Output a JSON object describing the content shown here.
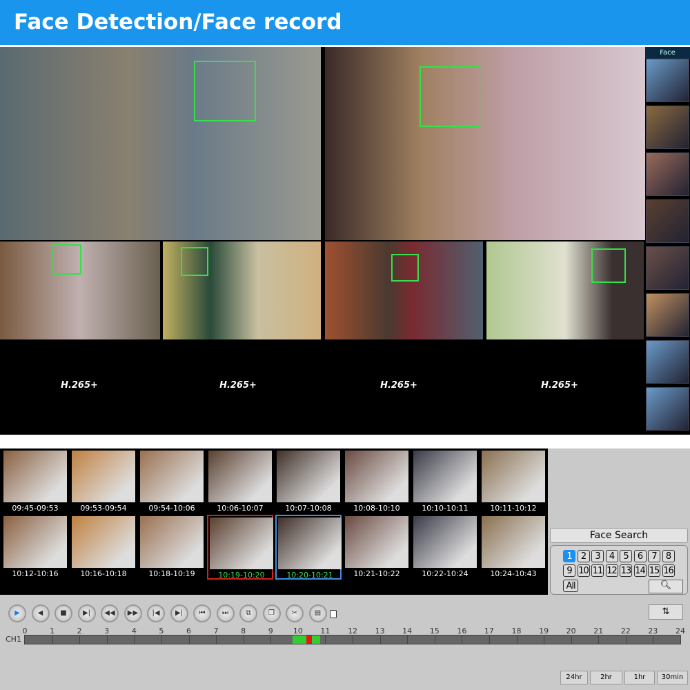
{
  "header": {
    "title": "Face Detection/Face record"
  },
  "video": {
    "codec_labels": [
      "H.265+",
      "H.265+",
      "H.265+",
      "H.265+"
    ],
    "face_strip_label": "Face"
  },
  "thumbnails": [
    {
      "time": "09:45-09:53"
    },
    {
      "time": "09:53-09:54"
    },
    {
      "time": "09:54-10:06"
    },
    {
      "time": "10:06-10:07"
    },
    {
      "time": "10:07-10:08"
    },
    {
      "time": "10:08-10:10"
    },
    {
      "time": "10:10-10:11"
    },
    {
      "time": "10:11-10:12"
    },
    {
      "time": "10:12-10:16"
    },
    {
      "time": "10:16-10:18"
    },
    {
      "time": "10:18-10:19"
    },
    {
      "time": "10:19-10:20",
      "state": "selected-red"
    },
    {
      "time": "10:20-10:21",
      "state": "selected-blue"
    },
    {
      "time": "10:21-10:22"
    },
    {
      "time": "10:22-10:24"
    },
    {
      "time": "10:24-10:43"
    }
  ],
  "face_search": {
    "title": "Face Search",
    "channels": [
      "1",
      "2",
      "3",
      "4",
      "5",
      "6",
      "7",
      "8",
      "9",
      "10",
      "11",
      "12",
      "13",
      "14",
      "15",
      "16"
    ],
    "selected_channel": "1",
    "all_label": "All",
    "search_icon": "magnifier-icon"
  },
  "controls": {
    "buttons": [
      "play",
      "reverse-play",
      "stop",
      "step-forward",
      "rewind",
      "fast-forward",
      "previous-frame",
      "next-frame",
      "skip-back",
      "skip-forward",
      "clip",
      "copy",
      "cut",
      "save"
    ],
    "swap_icon": "swap-icon"
  },
  "timeline": {
    "channel": "CH1",
    "hours": [
      "0",
      "1",
      "2",
      "3",
      "4",
      "5",
      "6",
      "7",
      "8",
      "9",
      "10",
      "11",
      "12",
      "13",
      "14",
      "15",
      "16",
      "17",
      "18",
      "19",
      "20",
      "21",
      "22",
      "23",
      "24"
    ],
    "recordings": [
      {
        "start": 9.8,
        "end": 10.3,
        "type": "normal",
        "color": "#33cc33"
      },
      {
        "start": 10.3,
        "end": 10.5,
        "type": "event",
        "color": "#e01818"
      },
      {
        "start": 10.5,
        "end": 10.8,
        "type": "normal",
        "color": "#33cc33"
      }
    ]
  },
  "zoom_buttons": [
    "24hr",
    "2hr",
    "1hr",
    "30min"
  ],
  "colors": {
    "accent": "#1a95ee",
    "face_box": "#35e04a"
  }
}
